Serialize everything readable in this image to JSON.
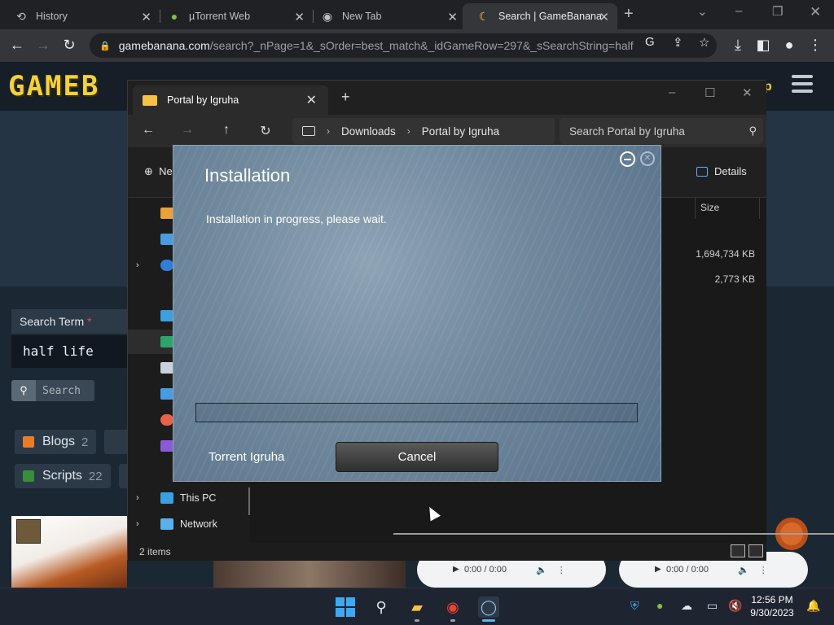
{
  "browser": {
    "tabs": [
      {
        "label": "History",
        "icon": "history-icon"
      },
      {
        "label": "µTorrent Web",
        "icon": "utorrent-icon"
      },
      {
        "label": "New Tab",
        "icon": "chrome-icon"
      },
      {
        "label": "Search | GameBanana",
        "icon": "gamebanana-icon"
      }
    ],
    "url_host": "gamebanana.com",
    "url_path": "/search?_nPage=1&_sOrder=best_match&_idGameRow=297&_sSearchString=half+l..."
  },
  "page": {
    "logo_text": "GAMEB",
    "header_right_text": "p",
    "search_label": "Search Term",
    "search_required_mark": "*",
    "search_value": "half life",
    "search_button": "Search",
    "chips": [
      {
        "label": "Blogs",
        "count": "2"
      },
      {
        "label": "Scripts",
        "count": "22"
      }
    ],
    "audio_players": [
      {
        "time": "0:00 / 0:00"
      },
      {
        "time": "0:00 / 0:00"
      }
    ]
  },
  "explorer": {
    "tab_title": "Portal by Igruha",
    "breadcrumb": [
      "Downloads",
      "Portal by Igruha"
    ],
    "search_placeholder": "Search Portal by Igruha",
    "new_label": "Ne",
    "details_label": "Details",
    "column_size": "Size",
    "file_sizes": [
      "1,694,734 KB",
      "2,773 KB"
    ],
    "sidebar_bottom": [
      {
        "label": "This PC"
      },
      {
        "label": "Network"
      }
    ],
    "status_items": "2 items"
  },
  "installer": {
    "title": "Installation",
    "message": "Installation in progress, please wait.",
    "progress": 0,
    "brand": "Torrent Igruha",
    "cancel_label": "Cancel"
  },
  "taskbar": {
    "time": "12:56 PM",
    "date": "9/30/2023"
  },
  "colors": {
    "accent": "#3ea8f2",
    "gb_yellow": "#f3d13a",
    "installer_bg": "#6f889c"
  }
}
